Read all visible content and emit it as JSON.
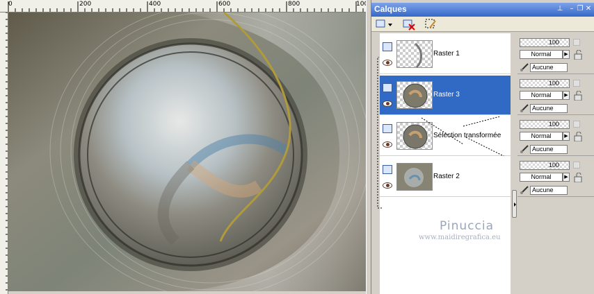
{
  "ruler": {
    "labels": [
      "0",
      "200",
      "400",
      "600",
      "800",
      "100"
    ]
  },
  "palette": {
    "title": "Calques",
    "layers": [
      {
        "name": "Raster 1",
        "opacity": "100",
        "blend": "Normal",
        "mask": "Aucune",
        "selected": false
      },
      {
        "name": "Raster 3",
        "opacity": "100",
        "blend": "Normal",
        "mask": "Aucune",
        "selected": true
      },
      {
        "name": "Sélection transformée",
        "opacity": "100",
        "blend": "Normal",
        "mask": "Aucune",
        "selected": false
      },
      {
        "name": "Raster 2",
        "opacity": "100",
        "blend": "Normal",
        "mask": "Aucune",
        "selected": false
      }
    ]
  },
  "watermark": {
    "name": "Pinuccia",
    "url": "www.maidiregrafica.eu"
  },
  "colors": {
    "selection": "#316ac5",
    "titlebar": "#3468c9"
  }
}
